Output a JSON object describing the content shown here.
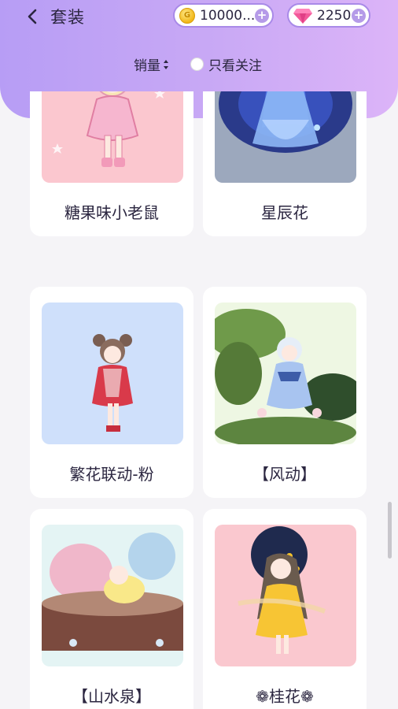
{
  "header": {
    "title": "套装",
    "coins": "10000...",
    "gems": "2250"
  },
  "filters": {
    "sort_label": "销量",
    "follow_label": "只看关注"
  },
  "items": [
    {
      "name": "糖果味小老鼠",
      "bg": "#fbc7cf"
    },
    {
      "name": "星辰花",
      "bg": "#9ca8bd"
    },
    {
      "name": "繁花联动-粉",
      "bg": "#cfe0fb"
    },
    {
      "name": "【风动】",
      "bg": "#eef7e3"
    },
    {
      "name": "【山水泉】",
      "bg": "#e4f4f4"
    },
    {
      "name": "❁桂花❁",
      "bg": "#fac8cf"
    }
  ],
  "colors": {
    "header_start": "#b79df5",
    "header_end": "#dcb4f8",
    "pill_border": "#a98ae8",
    "text": "#2b2640"
  },
  "icons": [
    "back-arrow-icon",
    "coin-icon",
    "gem-icon",
    "plus-icon",
    "sort-arrows-icon",
    "radio-unchecked-icon"
  ]
}
